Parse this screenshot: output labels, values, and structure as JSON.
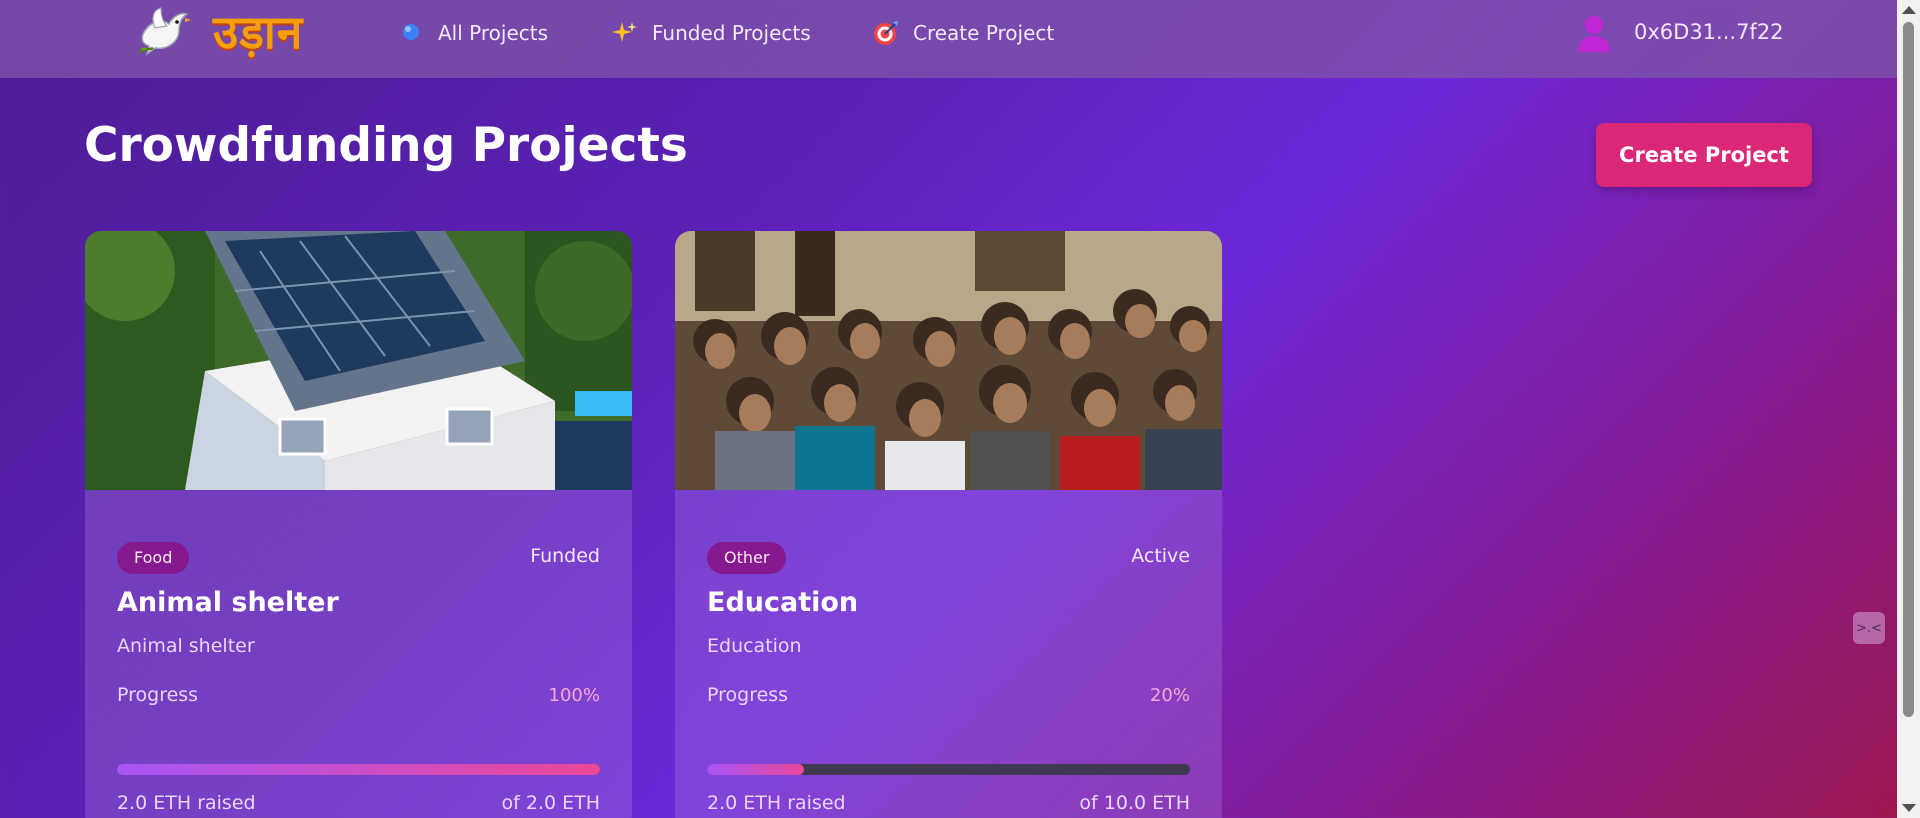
{
  "nav": {
    "logo_text": "उड़ान",
    "items": [
      {
        "label": "All Projects",
        "icon": "blue-dot-icon"
      },
      {
        "label": "Funded Projects",
        "icon": "sparkles-icon"
      },
      {
        "label": "Create Project",
        "icon": "target-icon"
      }
    ],
    "user_address": "0x6D31...7f22"
  },
  "page": {
    "title": "Crowdfunding Projects",
    "create_button": "Create Project"
  },
  "projects": [
    {
      "category": "Food",
      "status": "Funded",
      "title": "Animal shelter",
      "description": "Animal shelter",
      "progress_label": "Progress",
      "progress_text": "100%",
      "progress": 1.0,
      "raised": "2.0 ETH raised",
      "goal": "of 2.0 ETH",
      "image": "house-with-solar-panels"
    },
    {
      "category": "Other",
      "status": "Active",
      "title": "Education",
      "description": "Education",
      "progress_label": "Progress",
      "progress_text": "20%",
      "progress": 0.2,
      "raised": "2.0 ETH raised",
      "goal": "of 10.0 ETH",
      "image": "children-sitting-in-classroom"
    }
  ],
  "colors": {
    "accent": "#db2777",
    "badge": "#86198f",
    "logo": "#f59e0b"
  }
}
